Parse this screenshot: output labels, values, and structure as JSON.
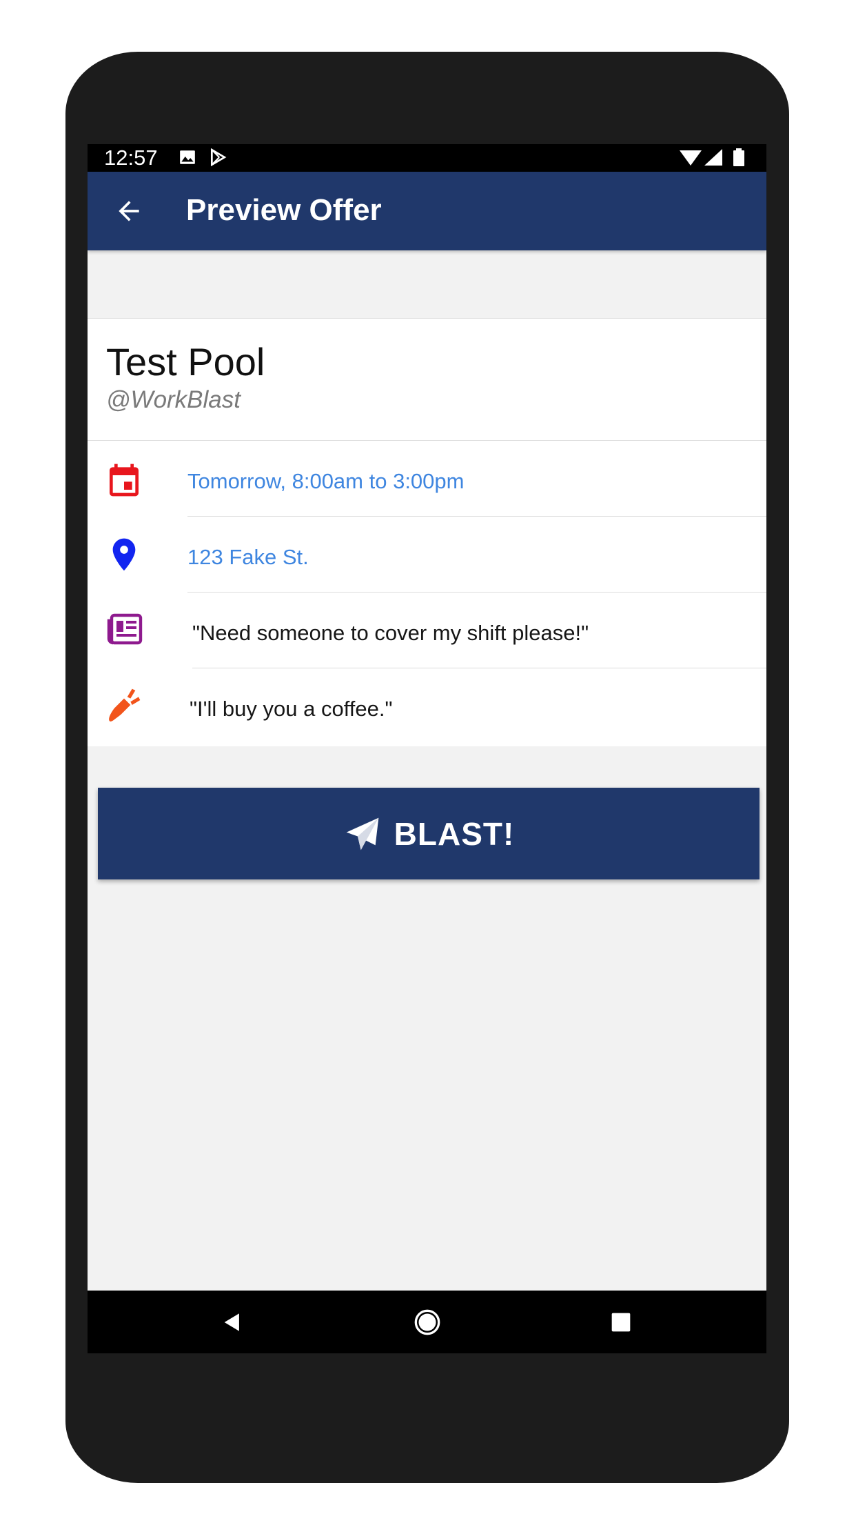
{
  "status_bar": {
    "time": "12:57",
    "left_icons": [
      "image-icon",
      "play-store-icon"
    ],
    "right_icons": [
      "wifi-icon",
      "signal-icon",
      "battery-icon"
    ]
  },
  "app_bar": {
    "title": "Preview Offer",
    "back_icon": "arrow-left-icon",
    "background_color": "#20386b"
  },
  "offer": {
    "pool_name": "Test Pool",
    "handle": "@WorkBlast",
    "rows": [
      {
        "icon": "calendar-icon",
        "icon_color": "#e8161d",
        "text": "Tomorrow, 8:00am to 3:00pm"
      },
      {
        "icon": "location-pin-icon",
        "icon_color": "#1225f0",
        "text": "123 Fake St."
      },
      {
        "icon": "newspaper-icon",
        "icon_color": "#8e1a8e",
        "text": "\"Need someone to cover my shift please!\""
      },
      {
        "icon": "carrot-icon",
        "icon_color": "#f2541b",
        "text": "\"I'll buy you a coffee.\""
      }
    ]
  },
  "blast_button": {
    "label": "BLAST!",
    "icon": "paper-plane-icon"
  },
  "nav_bar": {
    "icons": [
      "nav-back-icon",
      "nav-home-icon",
      "nav-recents-icon"
    ]
  }
}
